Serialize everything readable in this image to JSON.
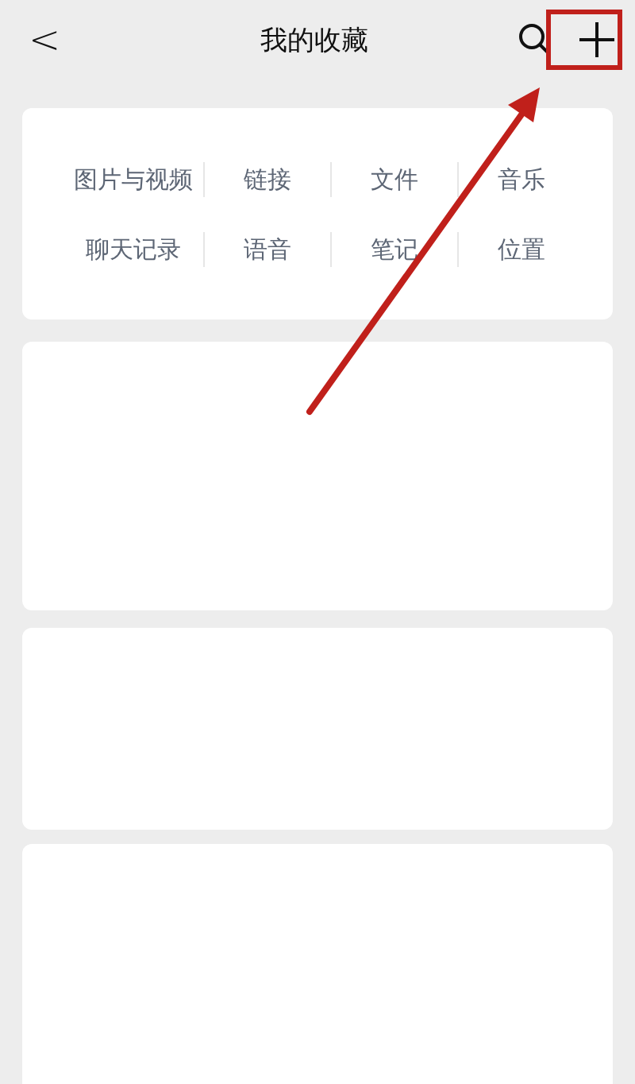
{
  "header": {
    "back": "<",
    "title": "我的收藏"
  },
  "categories": [
    {
      "label": "图片与视频"
    },
    {
      "label": "链接"
    },
    {
      "label": "文件"
    },
    {
      "label": "音乐"
    },
    {
      "label": "聊天记录"
    },
    {
      "label": "语音"
    },
    {
      "label": "笔记"
    },
    {
      "label": "位置"
    }
  ]
}
